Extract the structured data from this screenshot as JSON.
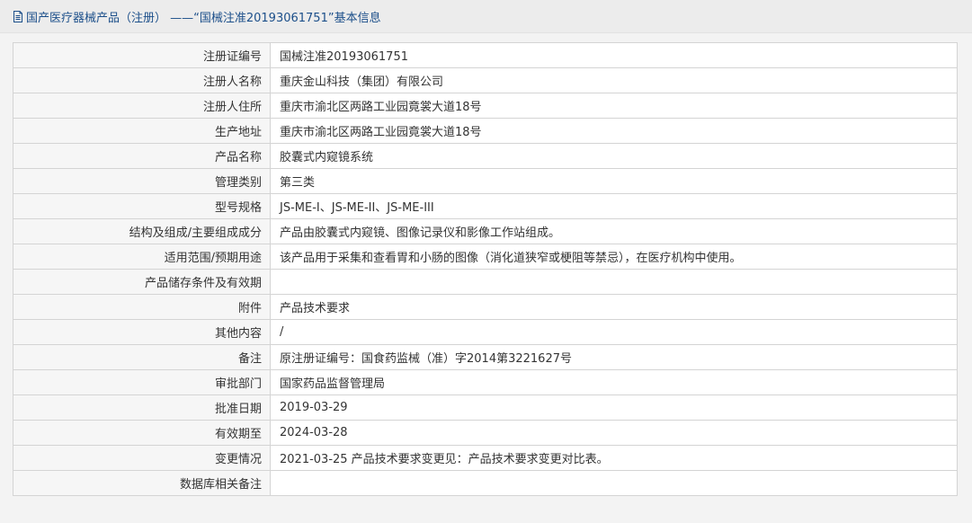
{
  "header": {
    "title": "国产医疗器械产品（注册） ——“国械注准20193061751”基本信息",
    "icon": "document-icon",
    "color": "#1c4f8a"
  },
  "rows": [
    {
      "label": "注册证编号",
      "value": "国械注准20193061751"
    },
    {
      "label": "注册人名称",
      "value": "重庆金山科技（集团）有限公司"
    },
    {
      "label": "注册人住所",
      "value": "重庆市渝北区两路工业园竟裳大道18号"
    },
    {
      "label": "生产地址",
      "value": "重庆市渝北区两路工业园竟裳大道18号"
    },
    {
      "label": "产品名称",
      "value": "胶囊式内窥镜系统"
    },
    {
      "label": "管理类别",
      "value": "第三类"
    },
    {
      "label": "型号规格",
      "value": "JS-ME-I、JS-ME-II、JS-ME-III"
    },
    {
      "label": "结构及组成/主要组成成分",
      "value": "产品由胶囊式内窥镜、图像记录仪和影像工作站组成。"
    },
    {
      "label": "适用范围/预期用途",
      "value": "该产品用于采集和查看胃和小肠的图像（消化道狭窄或梗阻等禁忌），在医疗机构中使用。"
    },
    {
      "label": "产品储存条件及有效期",
      "value": ""
    },
    {
      "label": "附件",
      "value": "产品技术要求"
    },
    {
      "label": "其他内容",
      "value": "/"
    },
    {
      "label": "备注",
      "value": "原注册证编号：国食药监械（准）字2014第3221627号"
    },
    {
      "label": "审批部门",
      "value": "国家药品监督管理局"
    },
    {
      "label": "批准日期",
      "value": "2019-03-29"
    },
    {
      "label": "有效期至",
      "value": "2024-03-28"
    },
    {
      "label": "变更情况",
      "value": "2021-03-25 产品技术要求变更见：产品技术要求变更对比表。"
    },
    {
      "label": "数据库相关备注",
      "value": ""
    }
  ]
}
